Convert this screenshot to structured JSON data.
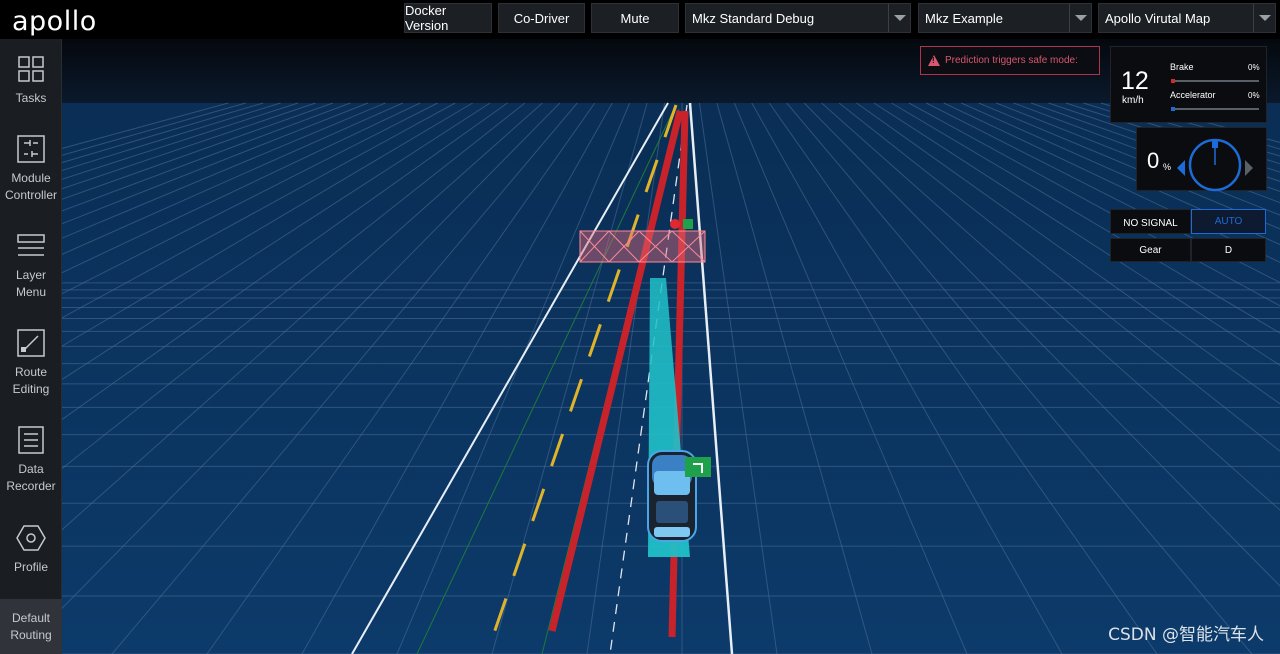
{
  "brand": {
    "logo": "apollo"
  },
  "header": {
    "docker_version": "Docker Version",
    "co_driver": "Co-Driver",
    "mute": "Mute",
    "mode_select": "Mkz Standard Debug",
    "vehicle_select": "Mkz Example",
    "map_select": "Apollo Virutal Map"
  },
  "sidebar": {
    "items": [
      {
        "label": "Tasks",
        "icon": "grid-icon"
      },
      {
        "label": "Module Controller",
        "icon": "sliders-icon"
      },
      {
        "label": "Layer Menu",
        "icon": "layers-icon"
      },
      {
        "label": "Route Editing",
        "icon": "route-icon"
      },
      {
        "label": "Data Recorder",
        "icon": "recorder-icon"
      },
      {
        "label": "Profile",
        "icon": "hexagon-icon"
      }
    ],
    "default_routing": "Default Routing"
  },
  "alert": {
    "message": "Prediction triggers safe mode:"
  },
  "dashboard": {
    "speed": "12",
    "speed_unit": "km/h",
    "brake_label": "Brake",
    "brake_value": "0%",
    "accelerator_label": "Accelerator",
    "accelerator_value": "0%",
    "brake_level": 0,
    "accelerator_level": 0,
    "steering_value": "0",
    "steering_unit": "%",
    "signal": "NO SIGNAL",
    "drive_mode": "AUTO",
    "gear_label": "Gear",
    "gear_value": "D"
  },
  "colors": {
    "ground": "#0c3a6a",
    "grid": "#4f6f95",
    "lane_white": "#e8eef5",
    "lane_yellow": "#e0b42a",
    "planning_red": "#c8232b",
    "planning_cyan": "#20c0c8",
    "auto_blue": "#1c6bd6",
    "alert": "#d8576f"
  },
  "watermark": "CSDN @智能汽车人"
}
